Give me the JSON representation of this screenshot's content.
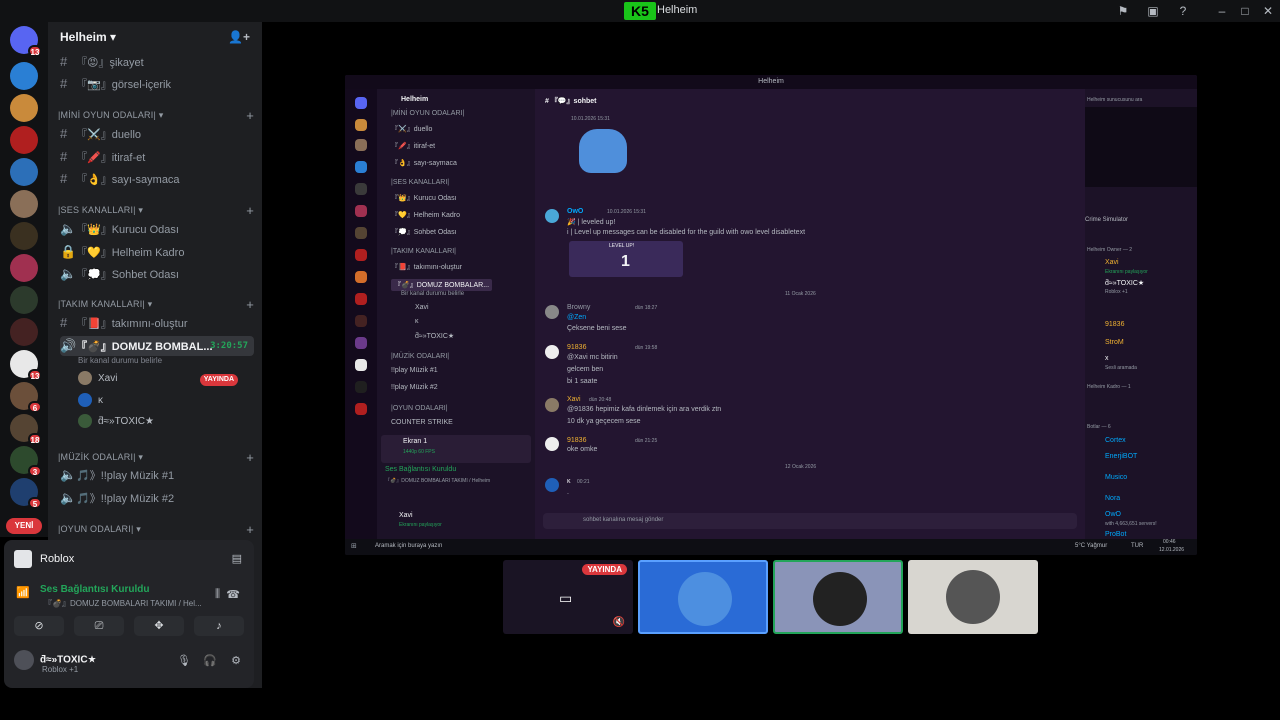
{
  "window": {
    "title": "Helheim",
    "logo_text": "K5",
    "icons": [
      "flag-icon",
      "inbox-icon",
      "help-icon",
      "minimize-icon",
      "maximize-icon",
      "close-icon"
    ]
  },
  "rail": {
    "badges": [
      "13",
      "13",
      "6",
      "18",
      "3",
      "5"
    ],
    "new_label": "YENİ"
  },
  "sidebar": {
    "guild_name": "Helheim",
    "channels_top": [
      {
        "name": "『😡』şikayet"
      },
      {
        "name": "『📷』görsel-içerik"
      }
    ],
    "cat_mini": "|MİNİ OYUN ODALARI|",
    "mini": [
      {
        "name": "『⚔️』duello"
      },
      {
        "name": "『🖍️』itiraf-et"
      },
      {
        "name": "『👌』sayı-saymaca"
      }
    ],
    "cat_ses": "|SES KANALLARI|",
    "ses": [
      {
        "name": "『👑』Kurucu Odası"
      },
      {
        "name": "『💛』Helheim Kadro"
      },
      {
        "name": "『💭』Sohbet Odası"
      }
    ],
    "cat_takim": "|TAKIM KANALLARI|",
    "takim_text": "『📕』takımını-oluştur",
    "active_voice": "『💣』DOMUZ BOMBAL...",
    "active_timer": "3:20:57",
    "status_hint": "Bir kanal durumu belirle",
    "members": [
      {
        "name": "Xavi",
        "live": "YAYINDA"
      },
      {
        "name": "ĸ",
        "live": ""
      },
      {
        "name": "ƌ≈»TOXIC★",
        "live": ""
      }
    ],
    "cat_muzik": "|MÜZİK ODALARI|",
    "muzik": [
      {
        "name": "🎵》!!play Müzik #1"
      },
      {
        "name": "🎵》!!play Müzik #2"
      }
    ],
    "cat_oyun": "|OYUN ODALARI|"
  },
  "panel": {
    "game": "Roblox",
    "voice_status": "Ses Bağlantısı Kuruldu",
    "voice_channel": "『💣』DOMUZ BOMBALARI TAKIMI / Hel...",
    "username": "ƌ≈»TOXIC★",
    "user_status": "Roblox +1"
  },
  "stream": {
    "window_title": "Helheim",
    "guild": "Helheim",
    "channel": "『💬』sohbet",
    "search_placeholder": "Helheim sunucusunu ara",
    "side_items": [
      "|MİNİ OYUN ODALARI|",
      "『⚔️』duello",
      "『🖍️』itiraf-et",
      "『👌』sayı-saymaca",
      "|SES KANALLARI|",
      "『👑』Kurucu Odası",
      "『💛』Helheim Kadro",
      "『💭』Sohbet Odası",
      "|TAKIM KANALLARI|",
      "『📕』takımını-oluştur",
      "『💣』DOMUZ BOMBALAR...",
      "Bir kanal durumu belirle",
      "Xavi",
      "ĸ",
      "ƌ≈»TOXIC★",
      "|MÜZİK ODALARI|",
      "!!play Müzik #1",
      "!!play Müzik #2",
      "|OYUN ODALARI|",
      "COUNTER STRIKE"
    ],
    "screen_label": "Ekran 1",
    "screen_sub": "1440p 60 FPS",
    "voice_status": "Ses Bağlantısı Kuruldu",
    "voice_channel": "『💣』DOMUZ BOMBALARI TAKIMI / Helheim",
    "user": "Xavi",
    "user_sub": "Ekranını paylaşıyor",
    "messages": [
      {
        "author": "",
        "time": "10.01.2026 15:31",
        "text": ""
      },
      {
        "author": "OwO",
        "time": "10.01.2026 15:31",
        "text": "🎉 | leveled up!"
      },
      {
        "author": "",
        "time": "",
        "text": "i | Level up messages can be disabled for the guild with owo level disabletext"
      },
      {
        "author": "",
        "time": "",
        "text": "LEVEL UP!"
      },
      {
        "author": "",
        "time": "",
        "text": "1"
      },
      {
        "author": "",
        "time": "",
        "text": "11 Ocak 2026"
      },
      {
        "author": "Browny",
        "time": "dün 18:27",
        "text": "@Zen"
      },
      {
        "author": "",
        "time": "",
        "text": "Çeksene beni sese"
      },
      {
        "author": "91836",
        "time": "dün 19:58",
        "text": "@Xavi mc bitirin"
      },
      {
        "author": "",
        "time": "",
        "text": "gelcem ben"
      },
      {
        "author": "",
        "time": "",
        "text": "bi 1 saate"
      },
      {
        "author": "Xavi",
        "time": "dün 20:48",
        "text": "@91836 hepimiz kafa dinlemek için ara verdik ztn"
      },
      {
        "author": "",
        "time": "",
        "text": "10 dk ya geçecem sese"
      },
      {
        "author": "91836",
        "time": "dün 21:25",
        "text": "oke omke"
      },
      {
        "author": "",
        "time": "",
        "text": "12 Ocak 2026"
      },
      {
        "author": "ĸ",
        "time": "00:21",
        "text": "."
      }
    ],
    "input_placeholder": "sohbet kanalına mesaj gönder",
    "members_header": [
      "Helheim Owner — 2",
      "Helheim Kadro — 1",
      "Botlar — 6"
    ],
    "members": [
      {
        "name": "Crime Simulator",
        "sub": ""
      },
      {
        "name": "Xavi",
        "sub": "Ekranını paylaşıyor"
      },
      {
        "name": "ƌ≈»TOXIC★",
        "sub": "Roblox +1"
      },
      {
        "name": "91836",
        "sub": ""
      },
      {
        "name": "StroM",
        "sub": ""
      },
      {
        "name": "x",
        "sub": "Sesli aramada"
      },
      {
        "name": "Cortex",
        "sub": ""
      },
      {
        "name": "EnerjiBOT",
        "sub": ""
      },
      {
        "name": "Musico",
        "sub": ""
      },
      {
        "name": "Nora",
        "sub": ""
      },
      {
        "name": "OwO",
        "sub": "with 4,663,651 servers!"
      },
      {
        "name": "ProBot",
        "sub": ""
      }
    ],
    "taskbar_search": "Aramak için buraya yazın",
    "weather": "5°C Yağmur",
    "lang": "TUR",
    "clock": "00:46",
    "date": "12.01.2026"
  },
  "thumbs": {
    "live_label": "YAYINDA"
  }
}
